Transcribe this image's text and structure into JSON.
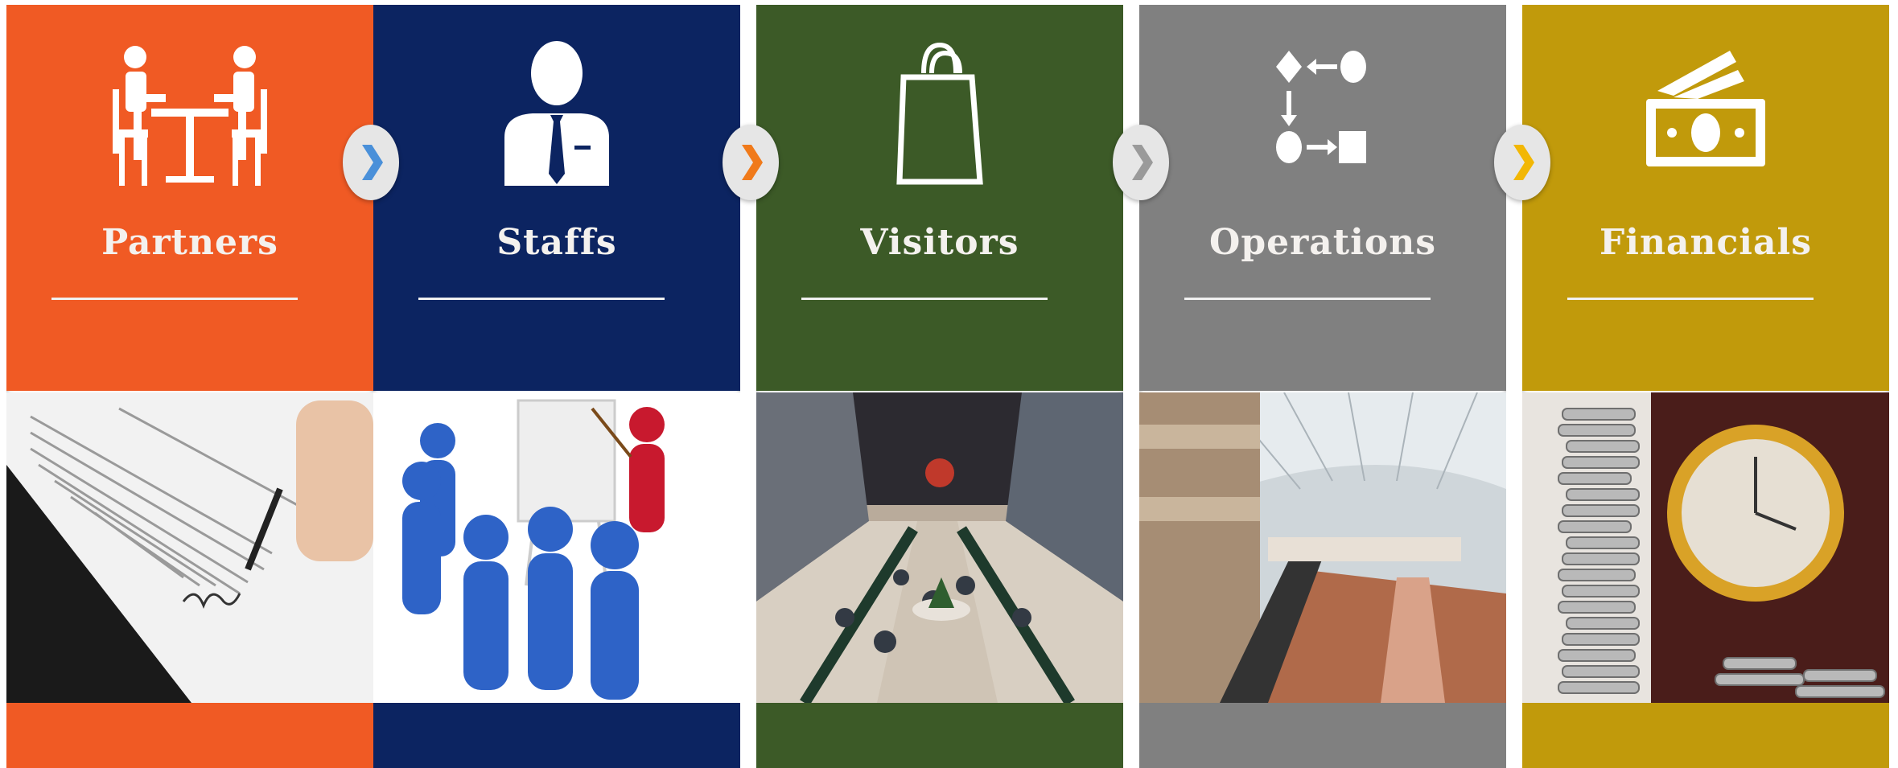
{
  "panels": [
    {
      "title": "Partners",
      "color": "#f05a24",
      "icon": "meeting-table-icon",
      "photo": "contract-signing-photo"
    },
    {
      "title": "Staffs",
      "color": "#0c2461",
      "icon": "businessman-icon",
      "photo": "training-figures-photo"
    },
    {
      "title": "Visitors",
      "color": "#3c5a27",
      "icon": "shopping-bag-icon",
      "photo": "mall-crowd-photo"
    },
    {
      "title": "Operations",
      "color": "#808080",
      "icon": "process-flow-icon",
      "photo": "mall-atrium-photo"
    },
    {
      "title": "Financials",
      "color": "#c19a0b",
      "icon": "cash-icon",
      "photo": "coins-clock-photo"
    }
  ],
  "arrows": [
    {
      "icon": "chevron-right-icon",
      "color": "#4a90d9"
    },
    {
      "icon": "chevron-right-icon",
      "color": "#f07a1a"
    },
    {
      "icon": "chevron-right-icon",
      "color": "#9a9a9a"
    },
    {
      "icon": "chevron-right-icon",
      "color": "#f2b705"
    }
  ]
}
